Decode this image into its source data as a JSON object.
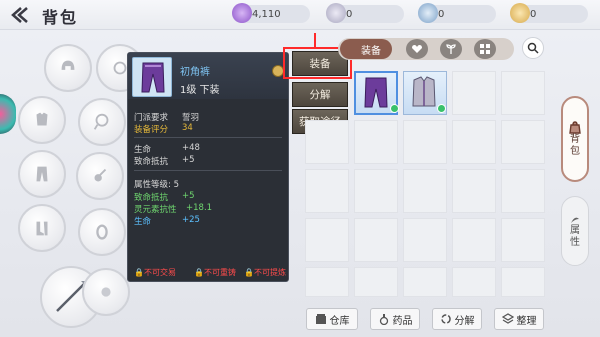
{
  "header": {
    "title": "背包"
  },
  "currencies": [
    {
      "name": "star-gem-icon",
      "value": "4,110",
      "color": "#a06ad6"
    },
    {
      "name": "silver-coin-icon",
      "value": "0",
      "color": "#a8a6bf"
    },
    {
      "name": "bag-coin-icon",
      "value": "0",
      "color": "#7aa0c8"
    },
    {
      "name": "gold-coin-icon",
      "value": "0",
      "color": "#d7a94a"
    }
  ],
  "tooltip": {
    "name": "初角裤",
    "level_type": "1级 下装",
    "rows": [
      {
        "label": "门派要求",
        "value": "誓羽"
      },
      {
        "label": "装备评分",
        "value": "34"
      },
      {
        "label": "生命",
        "value": "+48"
      },
      {
        "label": "致命抵抗",
        "value": "+5"
      },
      {
        "label": "属性等级: 5",
        "value": ""
      },
      {
        "label": "致命抵抗",
        "value": "+5"
      },
      {
        "label": "灵元素抗性",
        "value": "+18.1"
      },
      {
        "label": "生命",
        "value": "+25"
      }
    ],
    "warnings": [
      "不可交易",
      "不可重铸",
      "不可提炼"
    ]
  },
  "actions": {
    "equip": "装备",
    "decompose": "分解",
    "source": "获取途径"
  },
  "inventory": {
    "tab_equip": "装备"
  },
  "side_tabs": {
    "bag": "背\n包",
    "attr": "属\n性"
  },
  "bottom": {
    "warehouse": "仓库",
    "potion": "药品",
    "decompose": "分解",
    "sort": "整理"
  }
}
